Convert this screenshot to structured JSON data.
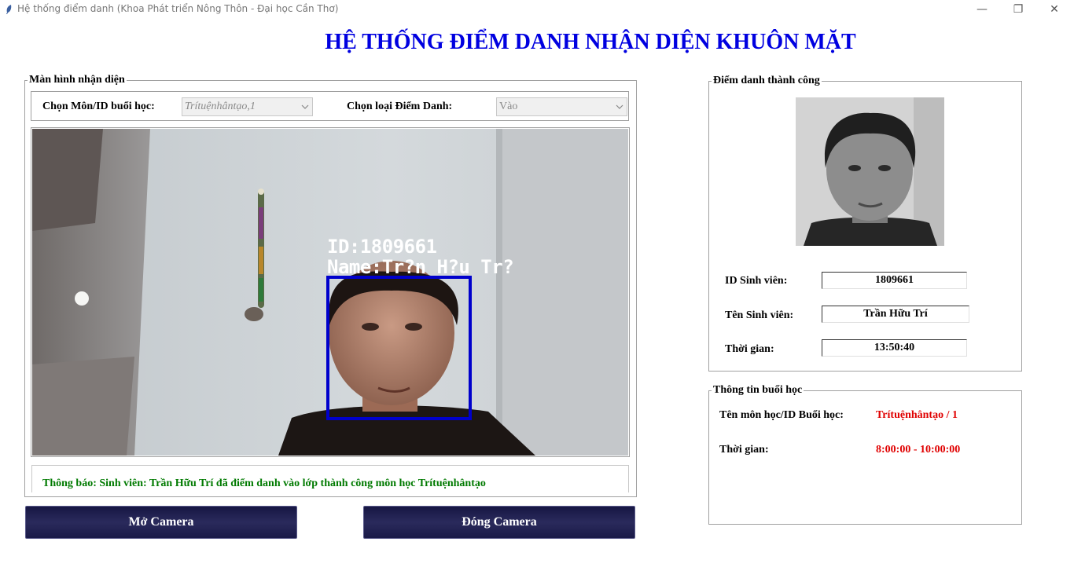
{
  "window": {
    "title": "Hệ thống điểm danh (Khoa Phát triển Nông Thôn - Đại học Cần Thơ)",
    "minimize": "—",
    "restore": "❐",
    "close": "✕"
  },
  "app_title": "HỆ THỐNG ĐIỂM DANH NHẬN DIỆN KHUÔN MẶT",
  "recognition": {
    "group_label": "Màn hình nhận diện",
    "subject_label": "Chọn Môn/ID buổi học:",
    "subject_value": "Trítuệnhântạo,1",
    "type_label": "Chọn loại Điểm Danh:",
    "type_value": "Vào",
    "overlay_id": "ID:1809661",
    "overlay_name": "Name:Tr?n H?u Tr?",
    "notice": "Thông báo: Sinh viên: Trần Hữu Trí đã điểm danh vào lớp thành công môn học Trítuệnhântạo",
    "colors": {
      "face_box": "#0000cc",
      "notice": "#007a00"
    }
  },
  "buttons": {
    "open_camera": "Mở Camera",
    "close_camera": "Đóng Camera"
  },
  "success": {
    "group_label": "Điểm danh thành công",
    "student_id_label": "ID Sinh viên:",
    "student_id": "1809661",
    "student_name_label": "Tên Sinh viên:",
    "student_name": "Trần Hữu Trí",
    "time_label": "Thời gian:",
    "time": "13:50:40"
  },
  "session": {
    "group_label": "Thông tin buổi học",
    "course_label": "Tên môn học/ID Buổi học:",
    "course_value": "Trítuệnhântạo / 1",
    "time_label": "Thời gian:",
    "time_value": "8:00:00 - 10:00:00",
    "value_color": "#e00000"
  }
}
